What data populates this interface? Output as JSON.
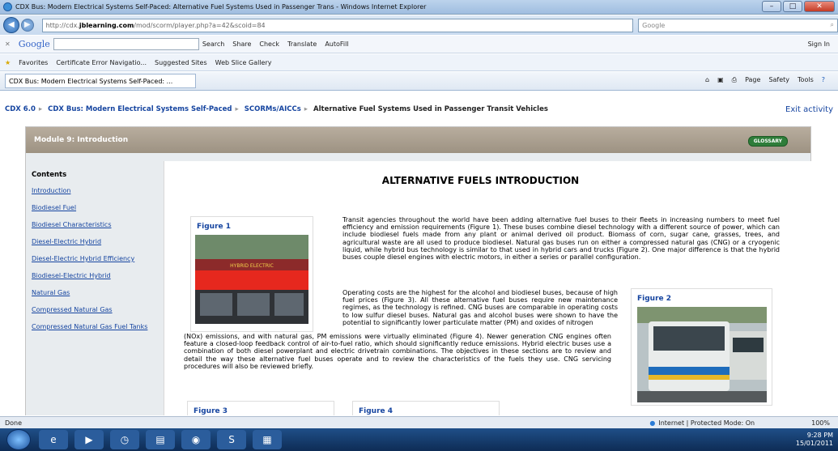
{
  "window": {
    "title": "CDX Bus: Modern Electrical Systems Self-Paced: Alternative Fuel Systems Used in Passenger Trans - Windows Internet Explorer"
  },
  "address": {
    "url_prefix": "http://cdx.",
    "url_domain": "jblearning.com",
    "url_path": "/mod/scorm/player.php?a=42&scoid=84",
    "search_placeholder": "Google"
  },
  "google_bar": {
    "logo": "Google",
    "items": [
      "Search",
      "Share",
      "Check",
      "Translate",
      "AutoFill",
      "Sign In"
    ]
  },
  "favorites": {
    "label": "Favorites",
    "items": [
      "Certificate Error Navigatio...",
      "Suggested Sites",
      "Web Slice Gallery"
    ]
  },
  "tab": {
    "label": "CDX Bus: Modern Electrical Systems Self-Paced: ...",
    "tools": [
      "Page",
      "Safety",
      "Tools"
    ]
  },
  "breadcrumb": [
    "CDX 6.0",
    "CDX Bus: Modern Electrical Systems Self-Paced",
    "SCORMs/AICCs",
    "Alternative Fuel Systems Used in Passenger Transit Vehicles"
  ],
  "exit": "Exit activity",
  "module": {
    "title": "Module 9: Introduction",
    "glossary": "GLOSSARY"
  },
  "contents": {
    "heading": "Contents",
    "items": [
      "Introduction",
      "Biodiesel Fuel",
      "Biodiesel Characteristics",
      "Diesel-Electric Hybrid",
      "Diesel-Electric Hybrid Efficiency",
      "Biodiesel-Electric Hybrid",
      "Natural Gas",
      "Compressed Natural Gas",
      "Compressed Natural Gas Fuel Tanks"
    ]
  },
  "article": {
    "title": "ALTERNATIVE FUELS INTRODUCTION",
    "fig1": "Figure 1",
    "fig2": "Figure 2",
    "fig3": "Figure 3",
    "fig4": "Figure 4",
    "bus_sign": "HYBRID ELECTRIC",
    "p1": "Transit agencies throughout the world have been adding alternative fuel buses to their fleets in increasing numbers to meet fuel efficiency and emission requirements (Figure 1). These buses combine diesel technology with a different source of power, which can include biodiesel fuels made from any plant or animal derived oil product. Biomass of corn, sugar cane, grasses, trees, and agricultural waste are all used to produce biodiesel. Natural gas buses run on either a compressed natural gas (CNG) or a cryogenic liquid, while hybrid bus technology is similar to that used in hybrid cars and trucks (Figure 2). One major difference is that the hybrid buses couple diesel engines with electric motors, in either a series or parallel configuration.",
    "p2": "Operating costs are the highest for the alcohol and biodiesel buses, because of high fuel prices (Figure 3). All these alternative fuel buses require new maintenance regimes, as the technology is refined. CNG buses are comparable in operating costs to low sulfur diesel buses. Natural gas and alcohol buses were shown to have the potential to significantly lower particulate matter (PM) and oxides of nitrogen",
    "p3": "(NOx) emissions, and with natural gas, PM emissions were virtually eliminated (Figure 4). Newer generation CNG engines often feature a closed-loop feedback control of air-to-fuel ratio, which should significantly reduce emissions. Hybrid electric buses use a combination of both diesel powerplant and electric drivetrain combinations. The objectives in these sections are to review and detail the way these alternative fuel buses operate and to review the characteristics of the fuels they use. CNG servicing procedures will also be reviewed briefly."
  },
  "status": {
    "left": "Done",
    "zone": "Internet | Protected Mode: On",
    "zoom": "100%"
  },
  "clock": {
    "time": "9:28 PM",
    "date": "15/01/2011"
  }
}
